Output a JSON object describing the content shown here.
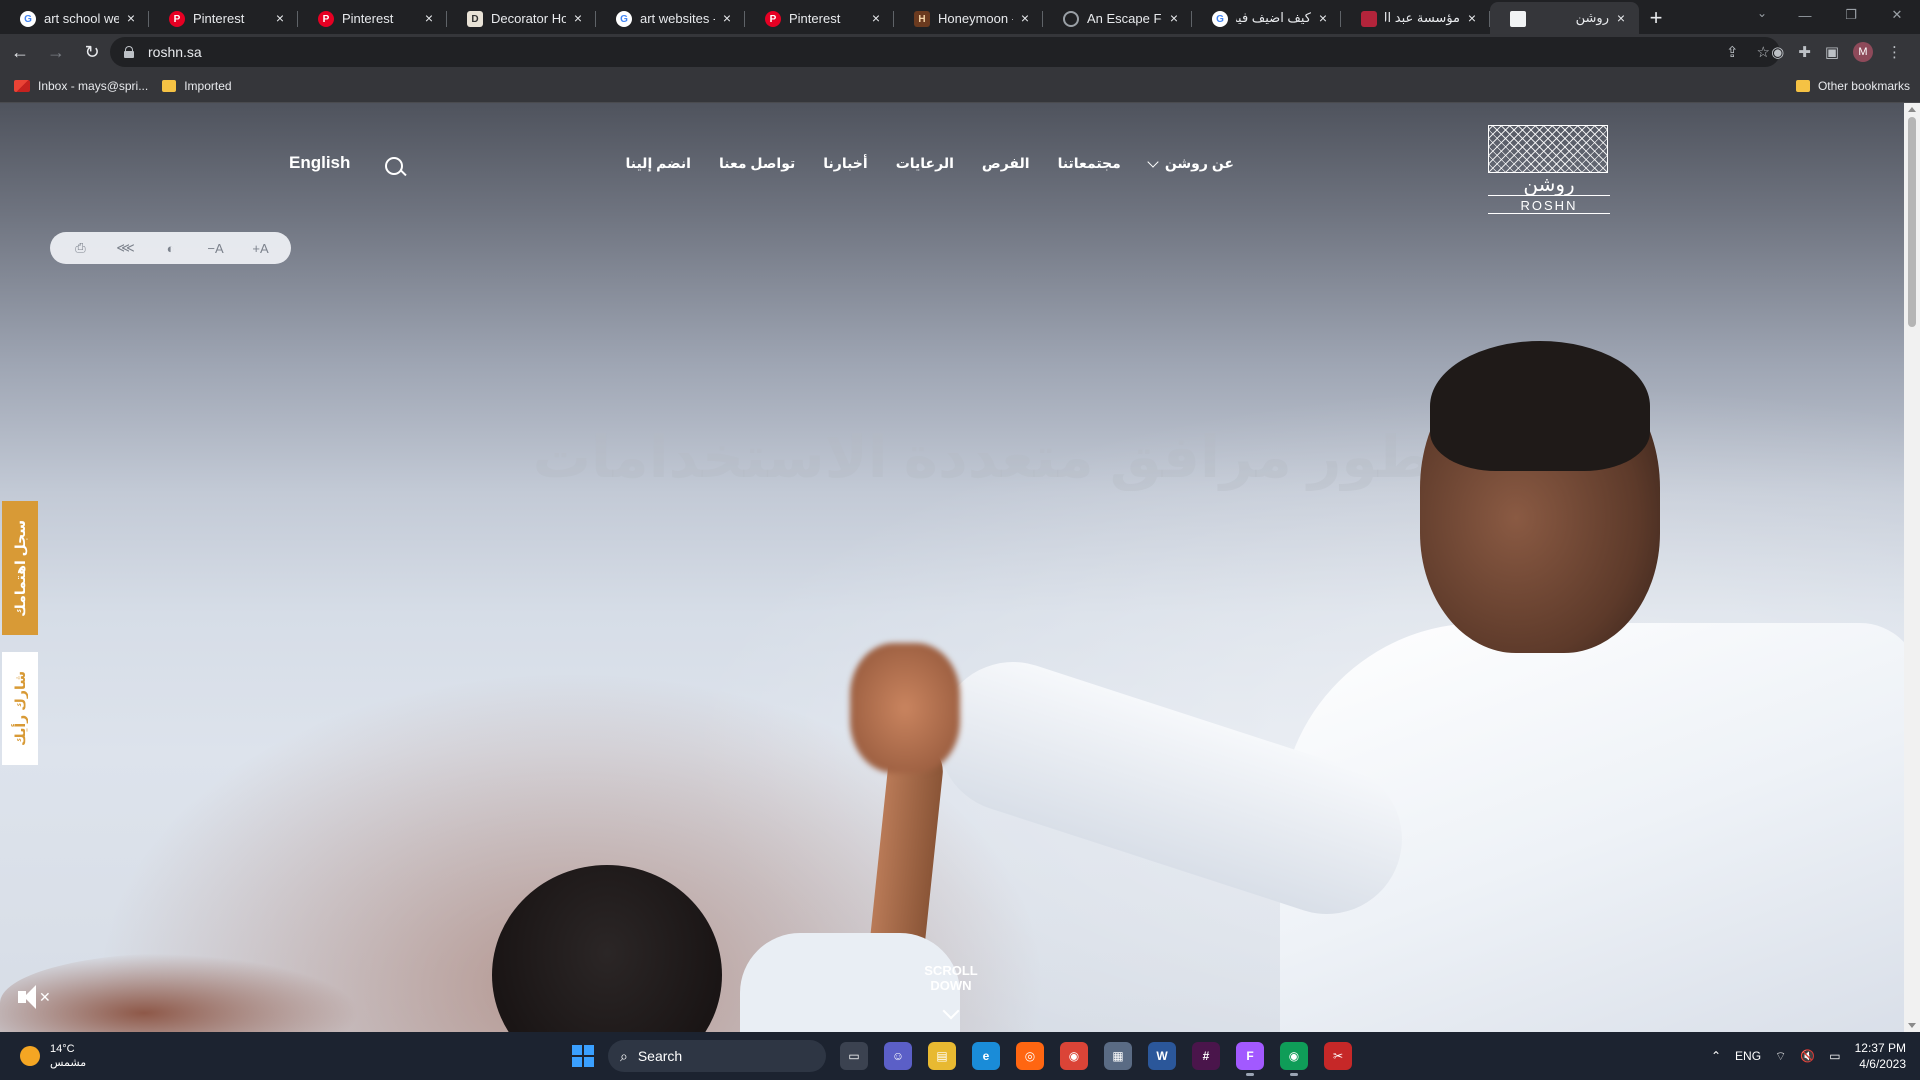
{
  "browser": {
    "tabs": [
      {
        "title": "art school websites",
        "icon": "google-icon",
        "kind": "google"
      },
      {
        "title": "Pinterest",
        "icon": "pinterest-icon",
        "kind": "pinterest"
      },
      {
        "title": "Pinterest",
        "icon": "pinterest-icon",
        "kind": "pinterest"
      },
      {
        "title": "Decorator Home",
        "icon": "decorator-icon",
        "kind": "deco"
      },
      {
        "title": "art websites - G",
        "icon": "google-icon",
        "kind": "google"
      },
      {
        "title": "Pinterest",
        "icon": "pinterest-icon",
        "kind": "pinterest"
      },
      {
        "title": "Honeymoon - W",
        "icon": "honeymoon-icon",
        "kind": "honey"
      },
      {
        "title": "An Escape For E",
        "icon": "globe-icon",
        "kind": "globe"
      },
      {
        "title": "كيف اضيف فيديو",
        "icon": "google-icon",
        "kind": "google"
      },
      {
        "title": "مؤسسة عبد المـ",
        "icon": "foundation-icon",
        "kind": "red"
      },
      {
        "title": "روشن",
        "icon": "page-icon",
        "kind": "doc",
        "active": true
      }
    ],
    "new_tab": "+",
    "url": "roshn.sa",
    "bookmarks": {
      "items": [
        {
          "label": "Inbox - mays@spri...",
          "icon": "gmail-icon"
        },
        {
          "label": "Imported",
          "icon": "folder-icon"
        }
      ],
      "other": "Other bookmarks"
    },
    "profile_initial": "M"
  },
  "site": {
    "nav": {
      "about": "عن روشن",
      "communities": "مجتمعاتنا",
      "opportunities": "الفرص",
      "sponsorships": "الرعايات",
      "news": "أخبارنا",
      "contact": "تواصل معنا",
      "join": "انضم إلينا"
    },
    "language": "English",
    "logo": {
      "arabic": "روشن",
      "english": "ROSHN"
    },
    "a11y": {
      "print": "⎙",
      "share": "⋘",
      "contrast": "◐",
      "decrease": "−A",
      "increase": "+A"
    },
    "side": {
      "register": "سجل اهتمامك",
      "feedback": "شارك رأيك"
    },
    "hero_text": "نطور مرافق متعددة الاستخدامات",
    "scroll_down": "SCROLL DOWN",
    "accent": "#d89a36"
  },
  "taskbar": {
    "weather": {
      "temp": "14°C",
      "condition": "مشمس"
    },
    "search_label": "Search",
    "language": "ENG",
    "time": "12:37 PM",
    "date": "4/6/2023"
  }
}
